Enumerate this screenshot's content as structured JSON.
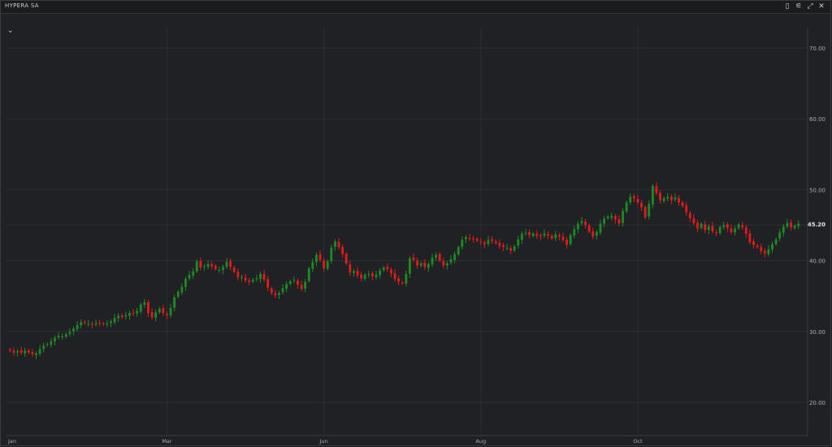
{
  "window": {
    "title": "HYPERA SA",
    "controls": [
      {
        "name": "bookmark-icon",
        "glyph": "▯"
      },
      {
        "name": "settings-sliders-icon",
        "glyph": "⚟"
      },
      {
        "name": "expand-icon",
        "glyph": "⤢"
      },
      {
        "name": "close-icon",
        "glyph": "✕"
      }
    ],
    "collapse_glyph": "⌄"
  },
  "colors": {
    "up": "#1f8a24",
    "down": "#e01b1b",
    "grid": "#2e2f33",
    "axis_text": "#a8acb2",
    "last_price_text": "#e6e8eb"
  },
  "chart_data": {
    "type": "candlestick",
    "title": "HYPERA SA",
    "x_tick_labels": [
      "Jan",
      "Mar",
      "Jun",
      "Aug",
      "Oct"
    ],
    "y_ticks": [
      "70.00",
      "60.00",
      "50.00",
      "40.00",
      "30.00",
      "20.00"
    ],
    "last_price": "45.20",
    "ylim": [
      15.5,
      72.5
    ],
    "grid": true,
    "closes": [
      27.3,
      27.0,
      27.2,
      27.0,
      27.3,
      27.0,
      26.8,
      26.9,
      27.5,
      28.0,
      28.2,
      28.6,
      29.1,
      29.4,
      29.3,
      29.6,
      29.9,
      30.4,
      30.9,
      31.3,
      31.2,
      31.1,
      31.0,
      31.1,
      31.2,
      31.0,
      31.1,
      31.4,
      31.9,
      32.2,
      32.0,
      32.3,
      32.6,
      32.5,
      32.9,
      33.8,
      34.1,
      32.6,
      32.0,
      32.7,
      33.2,
      32.6,
      32.3,
      33.3,
      34.8,
      35.6,
      36.3,
      37.4,
      38.0,
      38.5,
      39.9,
      39.0,
      39.2,
      39.5,
      39.2,
      38.8,
      38.7,
      39.1,
      39.8,
      39.1,
      38.4,
      37.6,
      37.7,
      37.2,
      37.0,
      37.3,
      37.5,
      38.1,
      37.3,
      36.2,
      35.4,
      35.1,
      35.4,
      36.1,
      36.7,
      37.1,
      37.3,
      36.6,
      36.0,
      37.0,
      38.9,
      39.8,
      40.8,
      40.1,
      38.9,
      39.9,
      41.8,
      42.7,
      41.9,
      40.9,
      39.6,
      38.3,
      38.5,
      37.9,
      37.5,
      38.0,
      38.1,
      37.8,
      38.0,
      38.6,
      39.0,
      38.8,
      38.2,
      37.4,
      37.0,
      36.8,
      38.1,
      40.3,
      40.1,
      39.3,
      39.6,
      39.1,
      39.5,
      40.4,
      40.8,
      40.0,
      39.3,
      39.6,
      40.2,
      40.9,
      41.9,
      42.9,
      43.3,
      43.1,
      43.0,
      42.8,
      42.6,
      42.3,
      42.9,
      42.8,
      42.5,
      42.1,
      41.9,
      41.8,
      41.4,
      42.0,
      43.0,
      43.8,
      43.9,
      43.6,
      43.8,
      43.5,
      43.4,
      43.8,
      43.5,
      43.1,
      43.7,
      43.4,
      42.9,
      42.2,
      43.6,
      44.4,
      45.2,
      45.6,
      45.0,
      44.1,
      43.4,
      44.0,
      45.2,
      45.9,
      46.2,
      46.3,
      45.8,
      45.2,
      47.0,
      48.2,
      49.0,
      48.8,
      48.2,
      47.5,
      46.1,
      48.0,
      50.5,
      49.5,
      48.5,
      48.8,
      49.0,
      48.5,
      48.9,
      48.2,
      47.7,
      46.8,
      46.0,
      45.3,
      44.5,
      45.2,
      44.3,
      44.8,
      44.1,
      43.9,
      44.7,
      45.0,
      44.6,
      44.0,
      44.5,
      45.1,
      44.7,
      43.8,
      42.6,
      42.2,
      41.9,
      41.3,
      41.0,
      41.6,
      42.3,
      43.0,
      44.0,
      44.8,
      45.3,
      44.7,
      44.9,
      45.2
    ]
  }
}
